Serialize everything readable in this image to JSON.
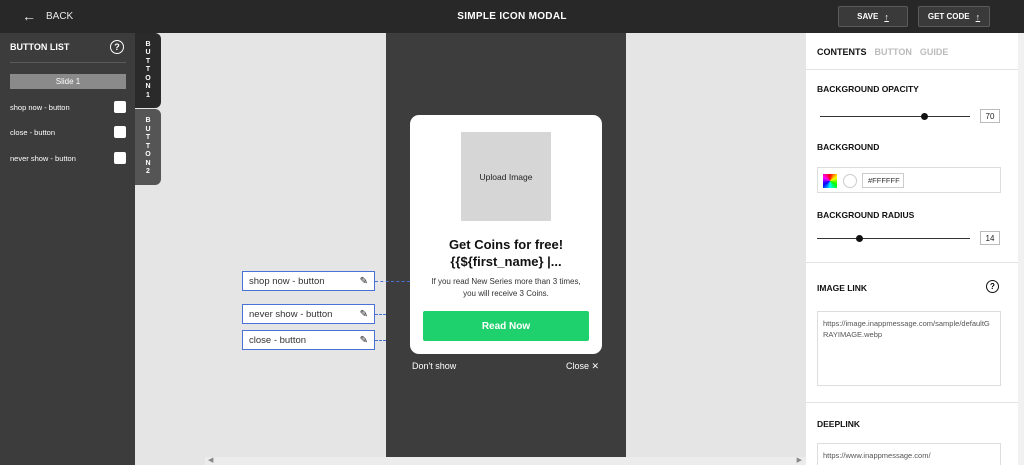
{
  "header": {
    "back_label": "BACK",
    "title": "SIMPLE ICON MODAL",
    "save_label": "SAVE",
    "getcode_label": "GET CODE"
  },
  "button_list": {
    "title": "BUTTON LIST",
    "help": "?",
    "slide_label": "Slide 1",
    "items": [
      {
        "label": "shop now - button"
      },
      {
        "label": "close - button"
      },
      {
        "label": "never show - button"
      }
    ]
  },
  "vertical_tabs": [
    {
      "letters": [
        "B",
        "U",
        "T",
        "T",
        "O",
        "N",
        "1"
      ]
    },
    {
      "letters": [
        "B",
        "U",
        "T",
        "T",
        "O",
        "N",
        "2"
      ]
    }
  ],
  "modal": {
    "upload_label": "Upload Image",
    "title_line1": "Get Coins for free!",
    "title_line2": "{{${first_name} |...",
    "desc_line1": "If you read New Series more than 3 times,",
    "desc_line2": "you will receive 3 Coins.",
    "cta_label": "Read Now",
    "dont_show_label": "Don't show",
    "close_label": "Close ✕"
  },
  "canvas_tags": [
    {
      "label": "shop now - button"
    },
    {
      "label": "never show - button"
    },
    {
      "label": "close - button"
    }
  ],
  "settings": {
    "tabs": [
      "CONTENTS",
      "BUTTON",
      "GUIDE"
    ],
    "active_tab": "CONTENTS",
    "bg_opacity_label": "BACKGROUND OPACITY",
    "bg_opacity_value": "70",
    "background_label": "BACKGROUND",
    "background_hex": "#FFFFFF",
    "bg_radius_label": "BACKGROUND RADIUS",
    "bg_radius_value": "14",
    "image_link_label": "IMAGE LINK",
    "image_link_help": "?",
    "image_link_value": "https://image.inappmessage.com/sample/defaultGRAYIMAGE.webp",
    "deeplink_label": "DEEPLINK",
    "deeplink_value": "https://www.inappmessage.com/"
  },
  "colors": {
    "topbar": "#282828",
    "left_panel": "#3c3c3c",
    "phone_bg": "#3d3d3d",
    "cta": "#1ed16c",
    "tag_border": "#4a72d6"
  }
}
